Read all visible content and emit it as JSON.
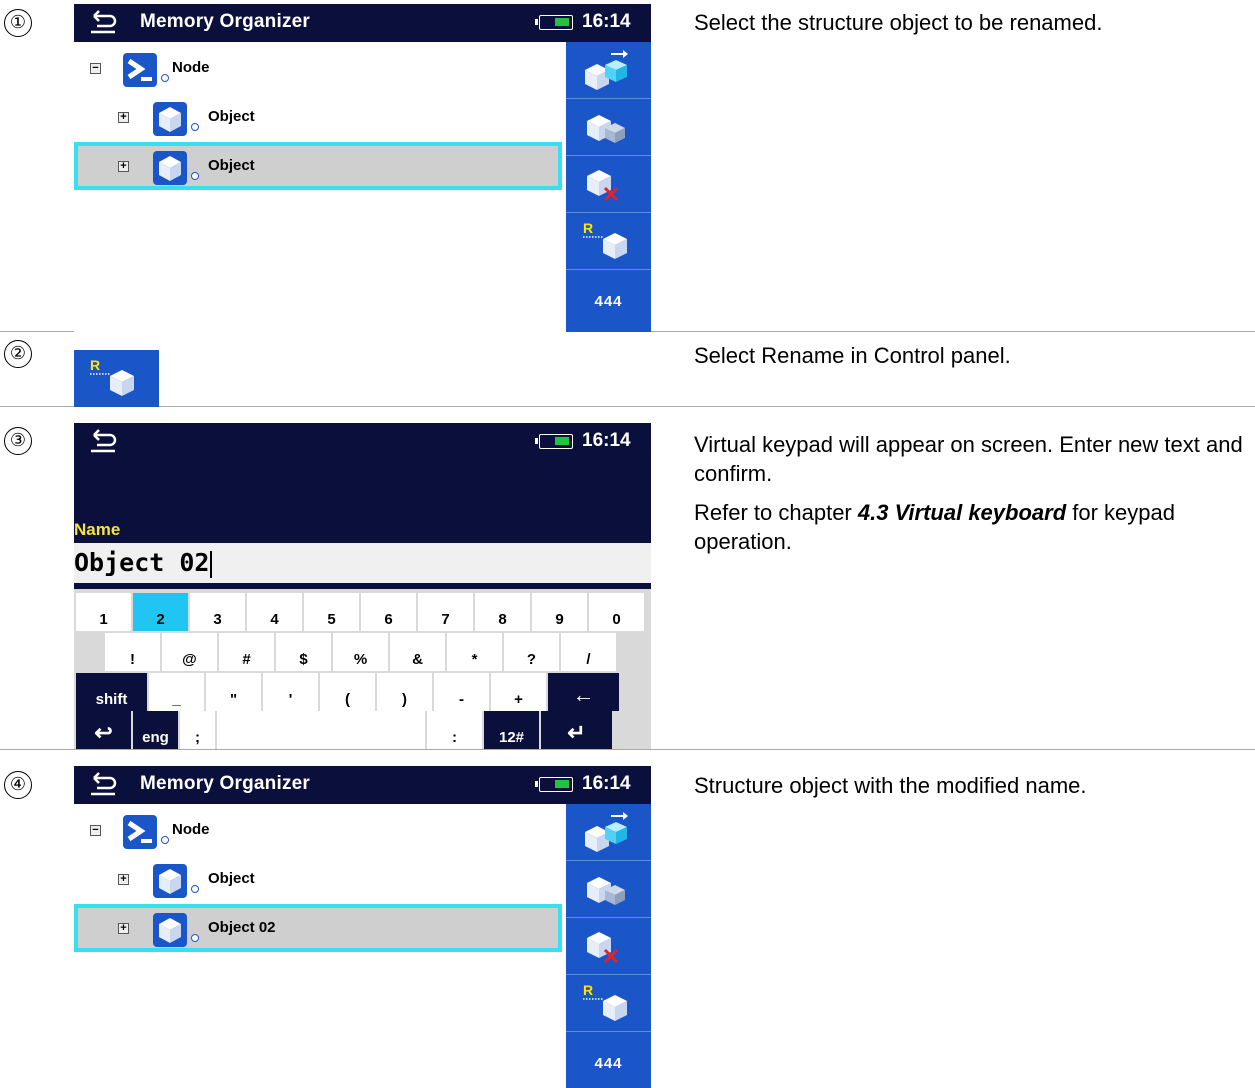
{
  "steps": [
    {
      "num": "①",
      "desc": [
        "Select the structure object to be renamed."
      ]
    },
    {
      "num": "②",
      "desc": [
        "Select Rename in Control panel."
      ]
    },
    {
      "num": "③",
      "desc": [
        "Virtual keypad will appear on screen. Enter new text and confirm."
      ],
      "ref": {
        "prefix": "Refer to chapter ",
        "link": "4.3 Virtual keyboard",
        "suffix": " for keypad operation."
      }
    },
    {
      "num": "④",
      "desc": [
        "Structure object with the modified name."
      ]
    }
  ],
  "device": {
    "title": "Memory Organizer",
    "time": "16:14",
    "more_label": "444"
  },
  "tree_before": [
    {
      "label": "Node",
      "toggle": "−",
      "icon": "node-icon"
    },
    {
      "label": "Object",
      "toggle": "+",
      "icon": "object-icon"
    },
    {
      "label": "Object",
      "toggle": "+",
      "icon": "object-icon",
      "selected": true
    }
  ],
  "tree_after": [
    {
      "label": "Node",
      "toggle": "−",
      "icon": "node-icon"
    },
    {
      "label": "Object",
      "toggle": "+",
      "icon": "object-icon"
    },
    {
      "label": "Object 02",
      "toggle": "+",
      "icon": "object-icon",
      "selected": true
    }
  ],
  "control_panel": [
    "add-object-icon",
    "clone-object-icon",
    "delete-object-icon",
    "rename-object-icon"
  ],
  "keyboard_screen": {
    "field_label": "Name",
    "field_value": "Object 02",
    "rows": [
      [
        "1",
        "2",
        "3",
        "4",
        "5",
        "6",
        "7",
        "8",
        "9",
        "0"
      ],
      [
        "!",
        "@",
        "#",
        "$",
        "%",
        "&",
        "*",
        "?",
        "/"
      ],
      [
        "shift",
        "_",
        "\"",
        "'",
        "(",
        ")",
        "-",
        "+",
        "←"
      ],
      [
        "↩",
        "eng",
        ";",
        " ",
        ":",
        "12#",
        "↵"
      ]
    ],
    "highlighted_key": "2"
  },
  "colors": {
    "titlebar": "#0b0f3b",
    "sidebar": "#1b56c8",
    "selection_border": "#38e0ee",
    "battery": "#21c43c",
    "highlight_key": "#21c5f2"
  }
}
